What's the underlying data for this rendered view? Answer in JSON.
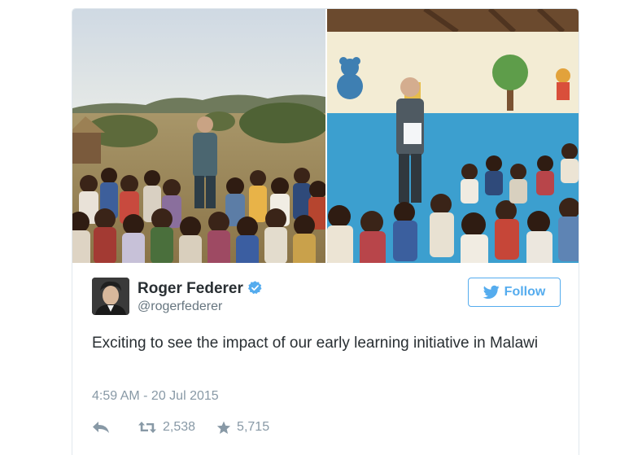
{
  "tweet": {
    "author": {
      "display_name": "Roger Federer",
      "screen_name": "@rogerfederer",
      "verified": true
    },
    "follow_label": "Follow",
    "text": "Exciting to see the impact of our early learning initiative in Malawi",
    "timestamp": "4:59 AM - 20 Jul 2015",
    "stats": {
      "retweets": "2,538",
      "likes": "5,715"
    },
    "media": [
      "outdoor-group-photo",
      "classroom-photo"
    ]
  },
  "colors": {
    "twitter_blue": "#55acee",
    "text": "#292f33",
    "muted": "#8899a6",
    "border": "#e1e8ed"
  },
  "icons": [
    "verified-icon",
    "twitter-bird-icon",
    "reply-icon",
    "retweet-icon",
    "star-icon"
  ]
}
